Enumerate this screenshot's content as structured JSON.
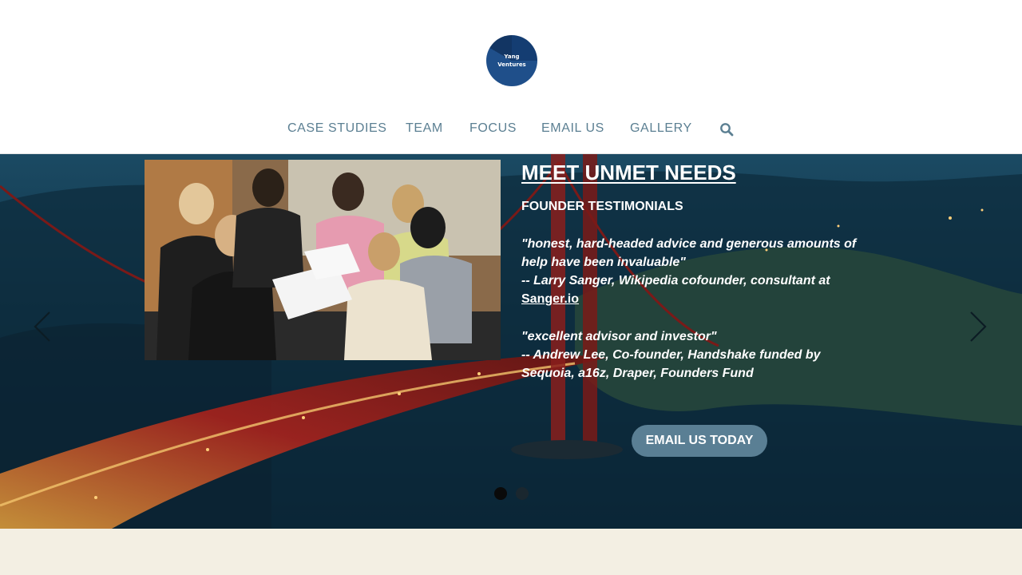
{
  "header": {
    "logo_text": [
      "Yang",
      "Ventures"
    ],
    "logo_color": "#143d72",
    "nav": [
      {
        "label": "CASE STUDIES"
      },
      {
        "label": "TEAM"
      },
      {
        "label": "FOCUS"
      },
      {
        "label": "EMAIL US"
      },
      {
        "label": "GALLERY"
      }
    ],
    "search_icon": "search-icon",
    "nav_color": "#5b7f92"
  },
  "hero": {
    "background": "golden-gate-bridge-night-photo",
    "photo": "founders-meeting-photo",
    "headline": "MEET UNMET NEEDS",
    "subheading": "FOUNDER TESTIMONIALS",
    "quote1": {
      "line1": "\"honest, hard-headed advice and generous amounts of",
      "line2": "help have been invaluable\"",
      "line3": "-- Larry Sanger, Wikipedia cofounder, consultant at",
      "link": "Sanger.io"
    },
    "quote2": {
      "line1": "\"excellent advisor and investor\"",
      "line2": "-- Andrew Lee, Co-founder, Handshake funded by",
      "line3": "Sequoia, a16z, Draper, Founders Fund"
    },
    "cta_label": "EMAIL US TODAY",
    "cta_color": "#5a7f94",
    "slides": {
      "total": 2,
      "active": 1
    }
  }
}
